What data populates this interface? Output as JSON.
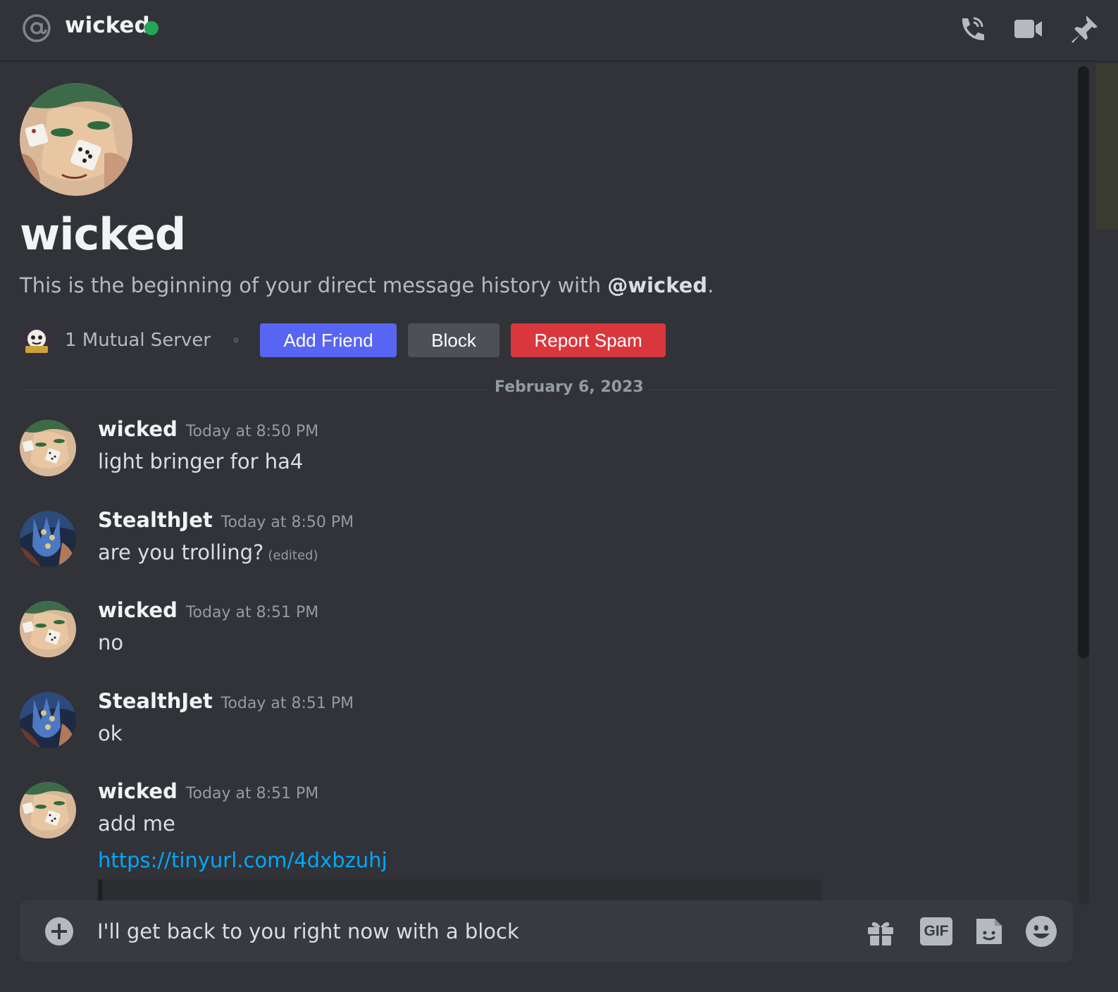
{
  "header": {
    "title": "wicked",
    "status": "online",
    "status_color": "#23a55a",
    "icons": [
      "at-sign-icon",
      "voice-call-icon",
      "video-call-icon",
      "pinned-messages-icon"
    ]
  },
  "profile": {
    "name": "wicked",
    "intro_prefix": "This is the beginning of your direct message history with ",
    "intro_handle": "@wicked",
    "intro_suffix": ".",
    "mutual_servers": "1 Mutual Server"
  },
  "actions": {
    "add_friend": "Add Friend",
    "block": "Block",
    "report_spam": "Report Spam"
  },
  "date_divider": "February 6, 2023",
  "messages": [
    {
      "author": "wicked",
      "time": "Today at 8:50 PM",
      "text": "light bringer for ha4"
    },
    {
      "author": "StealthJet",
      "time": "Today at 8:50 PM",
      "text": "are you trolling?",
      "edited": "(edited)"
    },
    {
      "author": "wicked",
      "time": "Today at 8:51 PM",
      "text": "no"
    },
    {
      "author": "StealthJet",
      "time": "Today at 8:51 PM",
      "text": "ok"
    },
    {
      "author": "wicked",
      "time": "Today at 8:51 PM",
      "text": "add me",
      "link": "https://tinyurl.com/4dxbzuhj"
    }
  ],
  "composer": {
    "value": "I'll get back to you right now with a block",
    "icons": [
      "plus-circle-icon",
      "gift-icon",
      "gif-icon",
      "sticker-icon",
      "emoji-icon"
    ],
    "gif_label": "GIF"
  },
  "colors": {
    "background": "#313338",
    "accent": "#5865f2",
    "danger": "#da373c",
    "link": "#00a8fc"
  }
}
